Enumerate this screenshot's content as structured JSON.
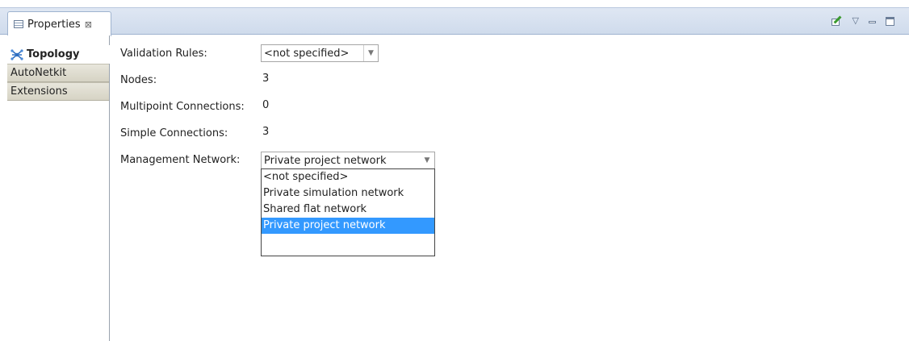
{
  "view_tab": {
    "label": "Properties",
    "close_glyph": "⊠"
  },
  "view_toolbar": {
    "menu_glyph": "▽"
  },
  "side_tabs": [
    {
      "label": "Topology",
      "icon": "topology-icon",
      "selected": true
    },
    {
      "label": "AutoNetkit",
      "selected": false
    },
    {
      "label": "Extensions",
      "selected": false
    }
  ],
  "form": {
    "validation_rules": {
      "label": "Validation Rules:",
      "value": "<not specified>"
    },
    "nodes": {
      "label": "Nodes:",
      "value": "3"
    },
    "multipoint": {
      "label": "Multipoint Connections:",
      "value": "0"
    },
    "simple": {
      "label": "Simple Connections:",
      "value": "3"
    },
    "management": {
      "label": "Management Network:",
      "value": "Private project network",
      "options": [
        "<not specified>",
        "Private simulation network",
        "Shared flat network",
        "Private project network"
      ],
      "highlighted_option": "Private project network"
    }
  },
  "colors": {
    "highlight": "#3399ff",
    "tabbar": "#cfdbec"
  }
}
